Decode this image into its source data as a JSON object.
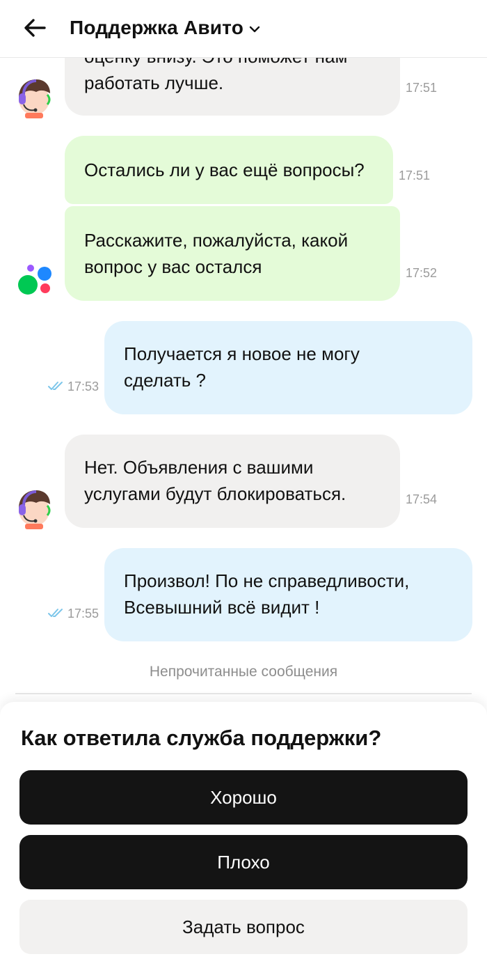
{
  "header": {
    "title": "Поддержка Авито",
    "back_icon": "arrow-left-icon",
    "dropdown_icon": "chevron-down-icon"
  },
  "messages": [
    {
      "from": "agent",
      "lines": [
        "оценку внизу. Это поможет нам",
        "работать лучше."
      ],
      "time": "17:51"
    },
    {
      "from": "bot",
      "lines": [
        "Остались ли у вас ещё вопросы?"
      ],
      "time": "17:51"
    },
    {
      "from": "bot",
      "lines": [
        "Расскажите, пожалуйста, какой",
        "вопрос у вас остался"
      ],
      "time": "17:52"
    },
    {
      "from": "user",
      "lines": [
        "Получается я новое не могу",
        "сделать  ?"
      ],
      "time": "17:53"
    },
    {
      "from": "agent",
      "lines": [
        "Нет. Объявления с вашими",
        "услугами будут блокироваться."
      ],
      "time": "17:54"
    },
    {
      "from": "user",
      "lines": [
        "Произвол! По не справедливости,",
        "Всевышний всё видит !"
      ],
      "time": "17:55"
    }
  ],
  "unread_label": "Непрочитанные сообщения",
  "rating": {
    "question": "Как ответила служба поддержки?",
    "good": "Хорошо",
    "bad": "Плохо",
    "ask": "Задать вопрос"
  },
  "colors": {
    "agent_bubble": "#f1f0ef",
    "bot_bubble": "#e4fbd8",
    "user_bubble": "#e2f3fd",
    "dark_button": "#141414",
    "read_ticks": "#7cc6ea"
  }
}
